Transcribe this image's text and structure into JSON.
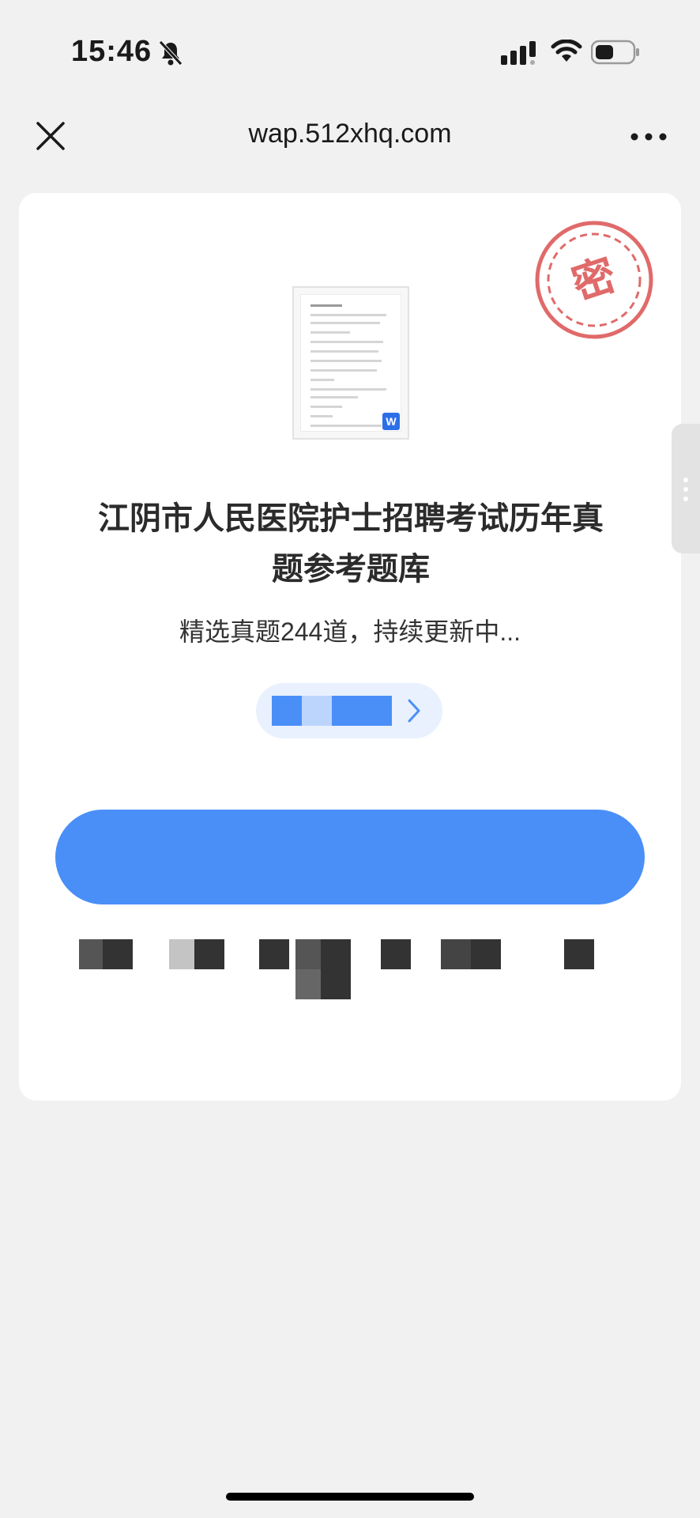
{
  "status_bar": {
    "time": "15:46",
    "icons": [
      "bell-slash-icon",
      "signal-icon",
      "wifi-icon",
      "battery-icon"
    ]
  },
  "nav_bar": {
    "url": "wap.512xhq.com",
    "icons": [
      "close-icon",
      "more-icon"
    ]
  },
  "card": {
    "stamp_char": "密",
    "doc_icon_letter": "W",
    "title": "江阴市人民医院护士招聘考试历年真题参考题库",
    "subtitle": "精选真题244道，持续更新中..."
  },
  "colors": {
    "accent": "#4a8ff8",
    "stamp": "#e06a6a",
    "background": "#f1f1f1",
    "card": "#ffffff"
  }
}
